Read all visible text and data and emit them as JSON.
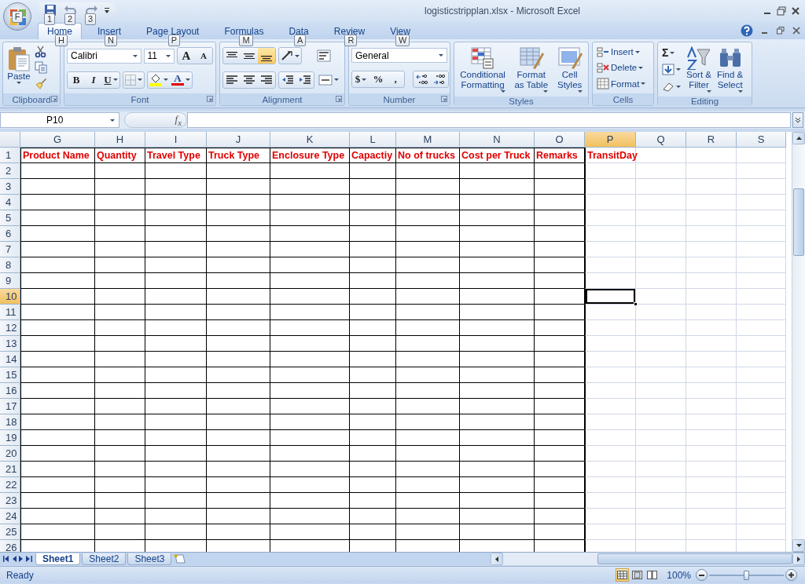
{
  "window": {
    "title": "logisticstripplan.xlsx - Microsoft Excel",
    "office_keytip": "F"
  },
  "quick_access": [
    {
      "keytip": "1"
    },
    {
      "keytip": "2"
    },
    {
      "keytip": "3"
    }
  ],
  "tabs": [
    {
      "label": "Home",
      "keytip": "H",
      "selected": true
    },
    {
      "label": "Insert",
      "keytip": "N",
      "selected": false
    },
    {
      "label": "Page Layout",
      "keytip": "P",
      "selected": false
    },
    {
      "label": "Formulas",
      "keytip": "M",
      "selected": false
    },
    {
      "label": "Data",
      "keytip": "A",
      "selected": false
    },
    {
      "label": "Review",
      "keytip": "R",
      "selected": false
    },
    {
      "label": "View",
      "keytip": "W",
      "selected": false
    }
  ],
  "ribbon": [
    {
      "kind": "clipboard",
      "label": "Clipboard",
      "paste": "Paste"
    },
    {
      "kind": "font",
      "label": "Font",
      "font_name": "Calibri",
      "size_field": "11",
      "grow": "A",
      "shrink": "A",
      "bold": "B",
      "italic": "I",
      "underline": "U",
      "font_color": "A"
    },
    {
      "kind": "alignment",
      "label": "Alignment"
    },
    {
      "kind": "number",
      "label": "Number",
      "format": "General",
      "currency": "$",
      "percent": "%",
      "comma": ","
    },
    {
      "kind": "styles",
      "label": "Styles",
      "buttons": [
        "Conditional\nFormatting",
        "Format\nas Table",
        "Cell\nStyles"
      ]
    },
    {
      "kind": "cells",
      "label": "Cells",
      "buttons": [
        "Insert",
        "Delete",
        "Format"
      ]
    },
    {
      "kind": "editing",
      "label": "Editing",
      "autosum": "Σ",
      "buttons": [
        "Sort &\nFilter",
        "Find &\nSelect"
      ]
    }
  ],
  "formula_bar": {
    "name_box": "P10",
    "function_label": "f$_{x}$"
  },
  "sheet": {
    "columns": [
      {
        "label": "G",
        "selected": false,
        "bordered": true
      },
      {
        "label": "H",
        "selected": false,
        "bordered": true
      },
      {
        "label": "I",
        "selected": false,
        "bordered": true
      },
      {
        "label": "J",
        "selected": false,
        "bordered": true
      },
      {
        "label": "K",
        "selected": false,
        "bordered": true
      },
      {
        "label": "L",
        "selected": false,
        "bordered": true
      },
      {
        "label": "M",
        "selected": false,
        "bordered": true
      },
      {
        "label": "N",
        "selected": false,
        "bordered": true
      },
      {
        "label": "O",
        "selected": false,
        "bordered": true
      },
      {
        "label": "P",
        "selected": true,
        "bordered": false
      },
      {
        "label": "Q",
        "selected": false,
        "bordered": false
      },
      {
        "label": "R",
        "selected": false,
        "bordered": false
      },
      {
        "label": "S",
        "selected": false,
        "bordered": false
      }
    ],
    "rows": [
      {
        "label": "1",
        "selected": false,
        "cells": [
          "Product Name",
          "Quantity",
          "Travel Type",
          "Truck Type",
          "Enclosure Type",
          "Capactiy",
          "No of trucks",
          "Cost per Truck",
          "Remarks",
          "TransitDay"
        ]
      },
      {
        "label": "2",
        "selected": false
      },
      {
        "label": "3",
        "selected": false
      },
      {
        "label": "4",
        "selected": false
      },
      {
        "label": "5",
        "selected": false
      },
      {
        "label": "6",
        "selected": false
      },
      {
        "label": "7",
        "selected": false
      },
      {
        "label": "8",
        "selected": false
      },
      {
        "label": "9",
        "selected": false
      },
      {
        "label": "10",
        "selected": true
      },
      {
        "label": "11",
        "selected": false
      },
      {
        "label": "12",
        "selected": false
      },
      {
        "label": "13",
        "selected": false
      },
      {
        "label": "14",
        "selected": false
      },
      {
        "label": "15",
        "selected": false
      },
      {
        "label": "16",
        "selected": false
      },
      {
        "label": "17",
        "selected": false
      },
      {
        "label": "18",
        "selected": false
      },
      {
        "label": "19",
        "selected": false
      },
      {
        "label": "20",
        "selected": false
      },
      {
        "label": "21",
        "selected": false
      },
      {
        "label": "22",
        "selected": false
      },
      {
        "label": "23",
        "selected": false
      },
      {
        "label": "24",
        "selected": false
      },
      {
        "label": "25",
        "selected": false
      },
      {
        "label": "26",
        "selected": false
      }
    ]
  },
  "sheet_tabs": [
    {
      "label": "Sheet1",
      "selected": true
    },
    {
      "label": "Sheet2",
      "selected": false
    },
    {
      "label": "Sheet3",
      "selected": false
    }
  ],
  "status_bar": {
    "text": "Ready",
    "zoom": "100%",
    "zoom_slider": {
      "level": 0.5
    }
  }
}
